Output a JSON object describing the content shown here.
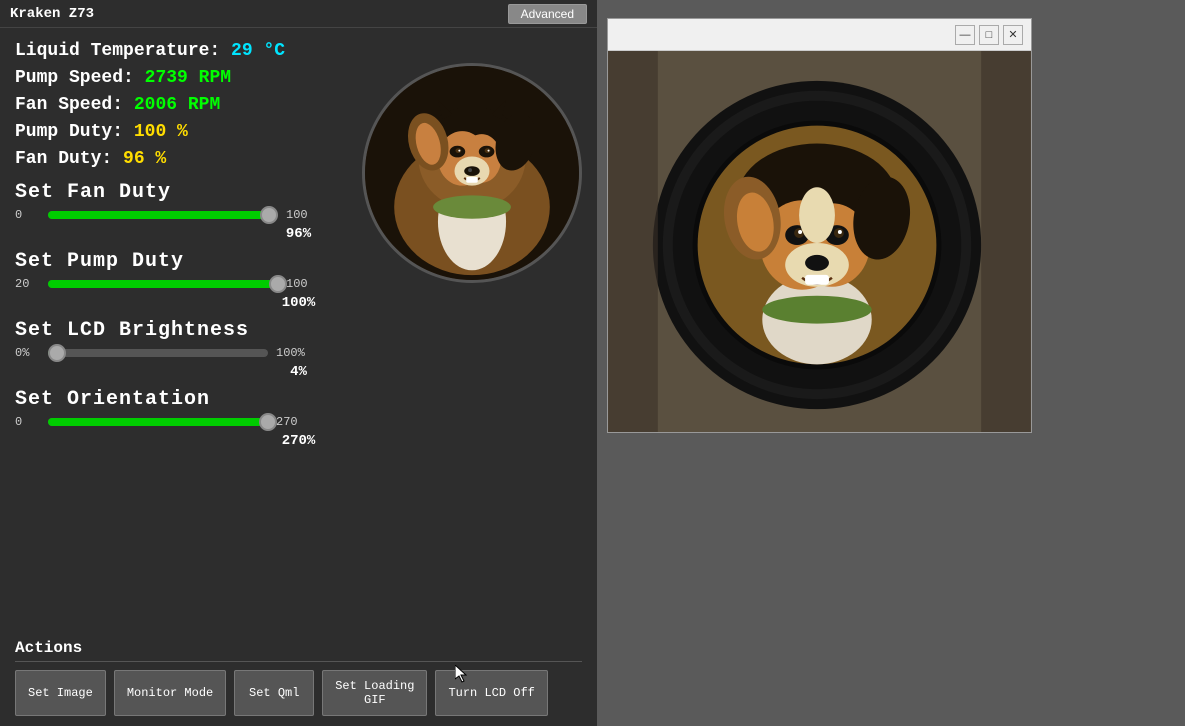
{
  "title": "Kraken Z73",
  "advanced_btn": "Advanced",
  "stats": {
    "liquid_temp_label": "Liquid Temperature:",
    "liquid_temp_value": "29 °C",
    "pump_speed_label": "Pump Speed:",
    "pump_speed_value": "2739 RPM",
    "fan_speed_label": "Fan Speed:",
    "fan_speed_value": "2006 RPM",
    "pump_duty_label": "Pump Duty:",
    "pump_duty_value": "100 %",
    "fan_duty_label": "Fan Duty:",
    "fan_duty_value": "96 %"
  },
  "fan_duty_section": {
    "label": "Set Fan Duty",
    "min": "0",
    "max": "100",
    "value_display": "96%",
    "fill_pct": 96
  },
  "pump_duty_section": {
    "label": "Set Pump Duty",
    "min": "20",
    "max": "100",
    "value_display": "100%",
    "fill_pct": 100
  },
  "lcd_brightness_section": {
    "label": "Set LCD Brightness",
    "min": "0%",
    "max": "100%",
    "value_display": "4%",
    "fill_pct": 4
  },
  "orientation_section": {
    "label": "Set Orientation",
    "min": "0",
    "max": "270",
    "value_display": "270%",
    "fill_pct": 100
  },
  "actions": {
    "label": "Actions",
    "buttons": [
      {
        "id": "set-image",
        "label": "Set Image"
      },
      {
        "id": "monitor-mode",
        "label": "Monitor Mode"
      },
      {
        "id": "set-qml",
        "label": "Set Qml"
      },
      {
        "id": "set-loading-gif",
        "label": "Set Loading\nGIF"
      },
      {
        "id": "turn-lcd-off",
        "label": "Turn LCD Off"
      }
    ]
  },
  "window_controls": {
    "minimize": "—",
    "maximize": "□",
    "close": "✕"
  }
}
